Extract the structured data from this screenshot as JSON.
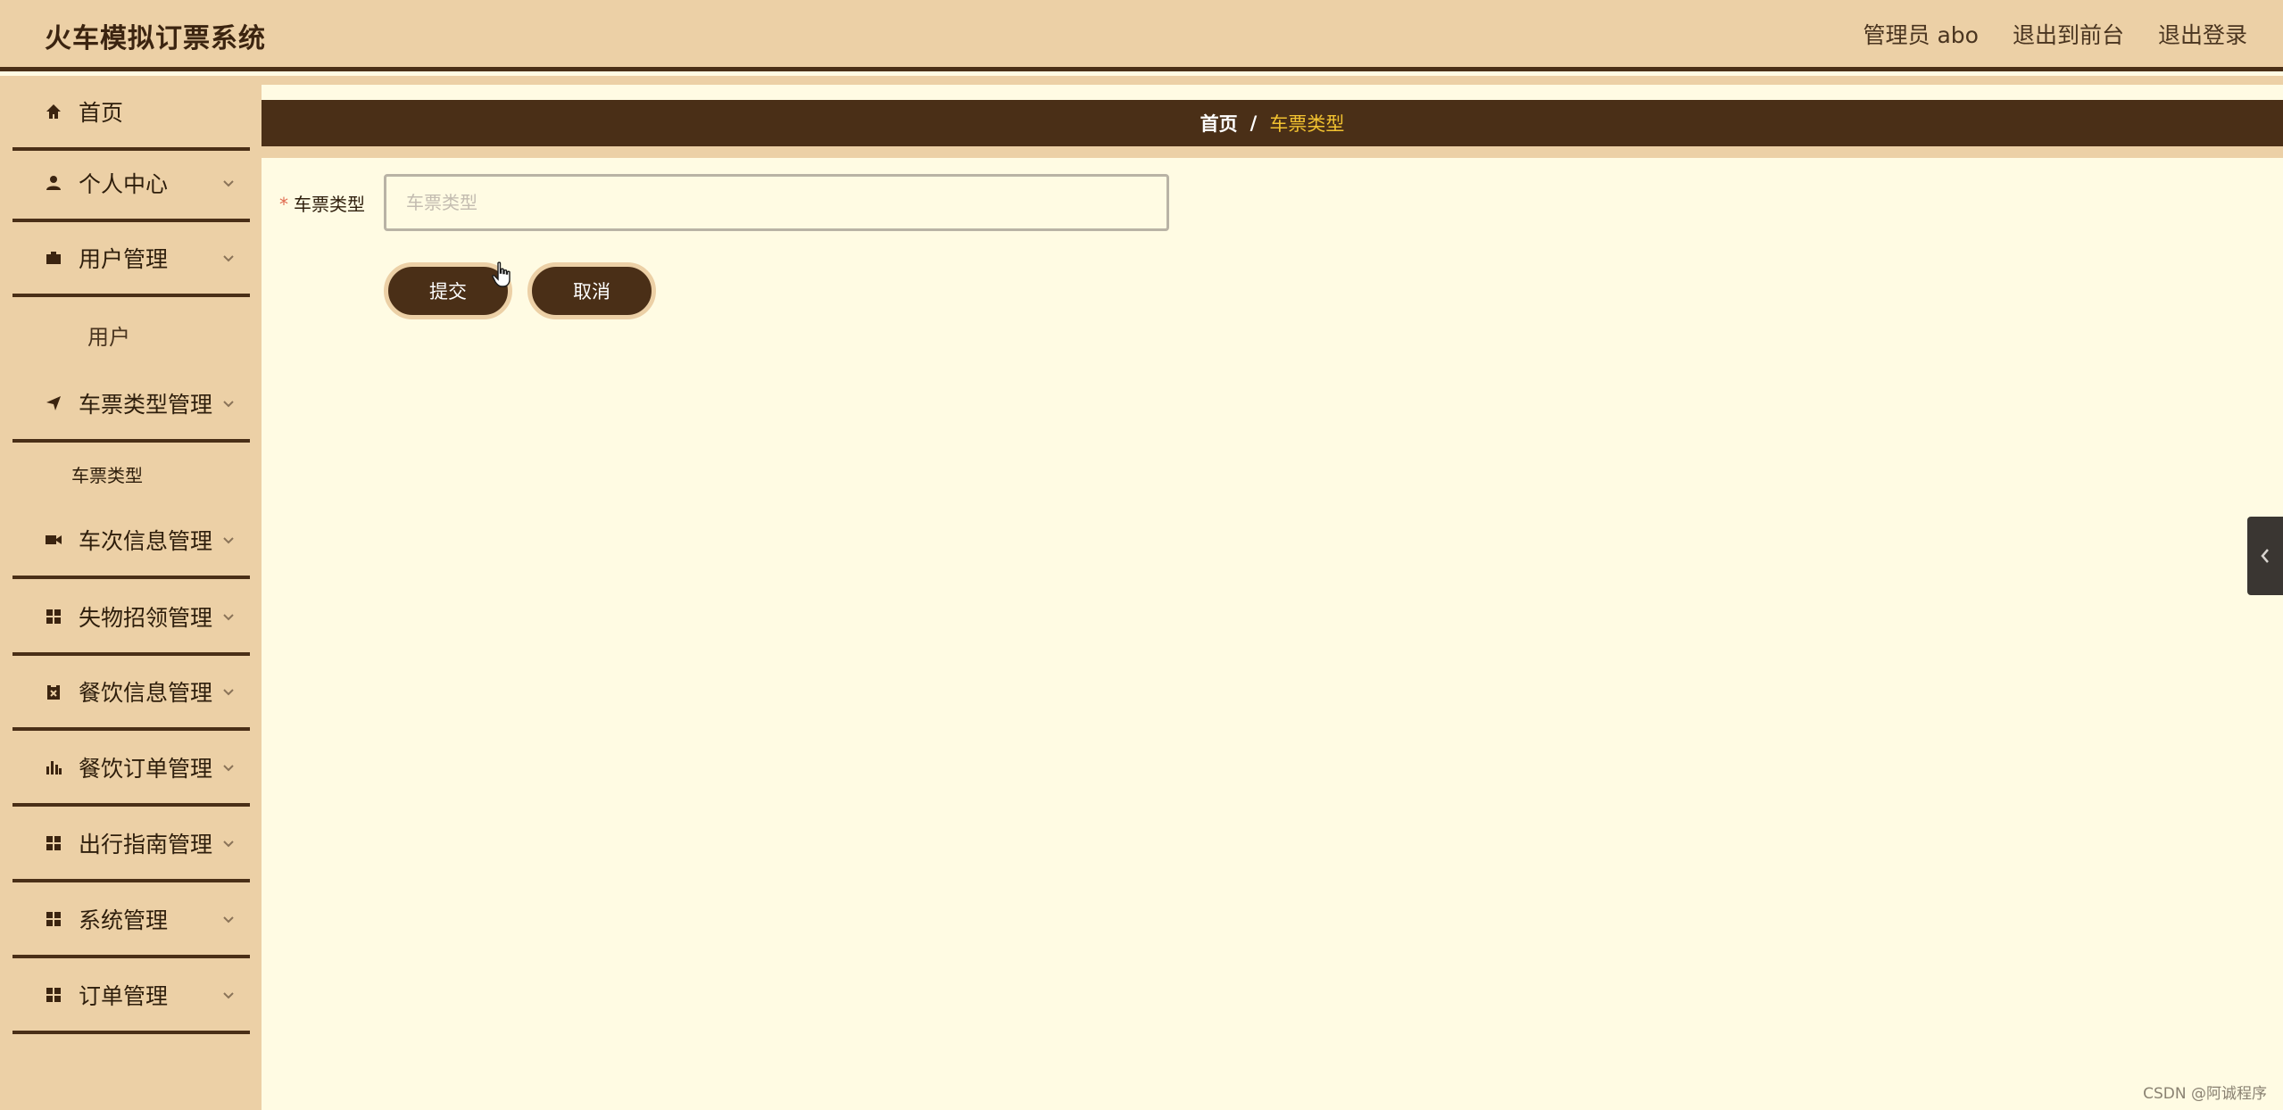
{
  "header": {
    "app_title": "火车模拟订票系统",
    "admin_label": "管理员 abo",
    "back_to_front": "退出到前台",
    "logout": "退出登录"
  },
  "sidebar": {
    "items": [
      {
        "label": "首页",
        "icon": "home-icon"
      },
      {
        "label": "个人中心",
        "icon": "user-icon"
      },
      {
        "label": "用户管理",
        "icon": "briefcase-icon"
      },
      {
        "label": "车票类型管理",
        "icon": "send-icon"
      },
      {
        "label": "车次信息管理",
        "icon": "video-icon"
      },
      {
        "label": "失物招领管理",
        "icon": "grid-icon"
      },
      {
        "label": "餐饮信息管理",
        "icon": "clipboard-icon"
      },
      {
        "label": "餐饮订单管理",
        "icon": "bar-chart-icon"
      },
      {
        "label": "出行指南管理",
        "icon": "grid-icon"
      },
      {
        "label": "系统管理",
        "icon": "grid-icon"
      },
      {
        "label": "订单管理",
        "icon": "grid-icon"
      }
    ],
    "sub_users": "用户",
    "sub_ticket_type": "车票类型"
  },
  "breadcrumb": {
    "home": "首页",
    "separator": "/",
    "current": "车票类型"
  },
  "form": {
    "field_label": "车票类型",
    "required_mark": "*",
    "field_placeholder": "车票类型",
    "field_value": "",
    "submit_label": "提交",
    "cancel_label": "取消"
  },
  "watermark": "CSDN @阿诚程序"
}
